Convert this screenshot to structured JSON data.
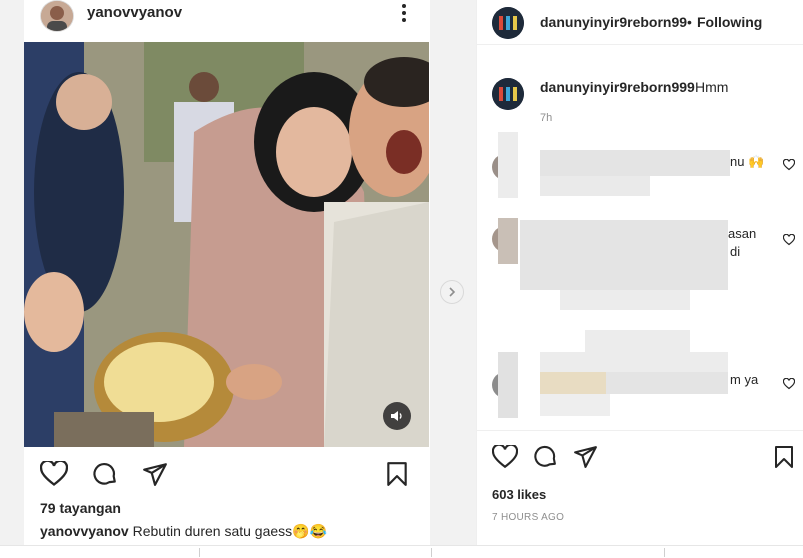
{
  "embed": {
    "username": "yanovvyanov",
    "views": "79 tayangan",
    "caption_user": "yanovvyanov",
    "caption_text": "Rebutin duren satu gaess",
    "caption_emojis": "🤭😂"
  },
  "icons": {
    "options": "more-options-icon",
    "like": "heart-icon",
    "comment": "comment-bubble-icon",
    "share": "paper-plane-icon",
    "save": "bookmark-icon",
    "next": "chevron-right-icon",
    "sound": "speaker-icon"
  },
  "post": {
    "author": "danunyinyir9reborn99",
    "separator": "•",
    "follow_status": "Following",
    "caption_user": "danunyinyir9reborn999",
    "caption_text": "Hmm",
    "caption_time": "7h",
    "likes": "603 likes",
    "time_ago": "7 HOURS AGO"
  },
  "comments": [
    {
      "visible_text": "nu 🙌"
    },
    {
      "visible_text": "asan"
    },
    {
      "visible_text": "di"
    },
    {
      "visible_text": "m ya"
    }
  ],
  "colors": {
    "text": "#262626",
    "muted": "#8e8e8e",
    "blur": "#e4e4e4"
  }
}
